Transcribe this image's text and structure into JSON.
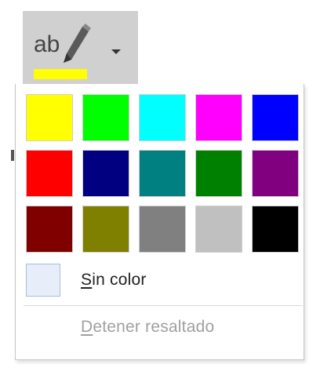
{
  "highlight_button": {
    "icon": "text-highlight-pen-icon",
    "current_color": "#ffff00",
    "dropdown_icon": "caret-down-icon"
  },
  "palette": {
    "colors": [
      "#ffff00",
      "#00ff00",
      "#00ffff",
      "#ff00ff",
      "#0000ff",
      "#ff0000",
      "#000080",
      "#008080",
      "#008000",
      "#800080",
      "#800000",
      "#808000",
      "#808080",
      "#c0c0c0",
      "#000000"
    ]
  },
  "menu": {
    "no_color": {
      "first": "S",
      "rest": "in color"
    },
    "stop_highlighting": {
      "first": "D",
      "rest": "etener resaltado"
    }
  }
}
